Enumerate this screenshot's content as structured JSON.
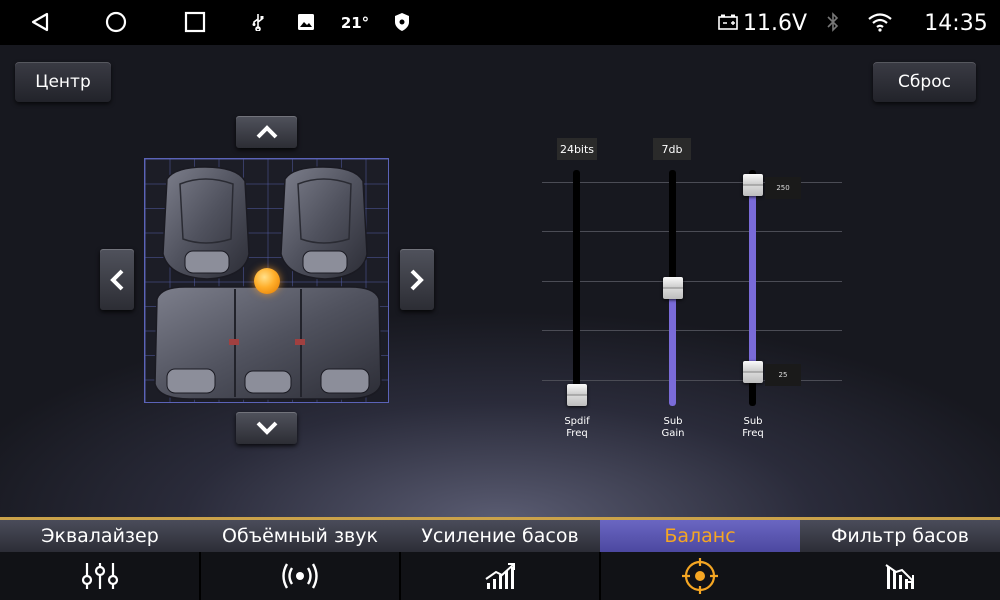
{
  "status_bar": {
    "temperature": "21°",
    "voltage": "11.6V",
    "time": "14:35"
  },
  "top_buttons": {
    "center_label": "Центр",
    "reset_label": "Сброс"
  },
  "sliders": [
    {
      "value_label": "24bits",
      "label_line1": "Spdif",
      "label_line2": "Freq",
      "level": 0
    },
    {
      "value_label": "7db",
      "label_line1": "Sub",
      "label_line2": "Gain",
      "level": 0.5
    },
    {
      "value_label_top": "250",
      "value_label_bottom": "25",
      "label_line1": "Sub",
      "label_line2": "Freq",
      "range": [
        0.05,
        1.0
      ]
    }
  ],
  "tabs": [
    {
      "label": "Эквалайзер",
      "icon": "equalizer-sliders-icon",
      "active": false
    },
    {
      "label": "Объёмный звук",
      "icon": "surround-sound-icon",
      "active": false
    },
    {
      "label": "Усиление басов",
      "icon": "bass-boost-chart-icon",
      "active": false
    },
    {
      "label": "Баланс",
      "icon": "balance-target-icon",
      "active": true
    },
    {
      "label": "Фильтр басов",
      "icon": "bass-filter-chart-icon",
      "active": false
    }
  ],
  "colors": {
    "accent": "#f5a623",
    "active_tab": "#5c58b0",
    "slider_fill": "#7a6bd8",
    "balance_point": "#ffa020",
    "tab_border": "#caa24a"
  }
}
